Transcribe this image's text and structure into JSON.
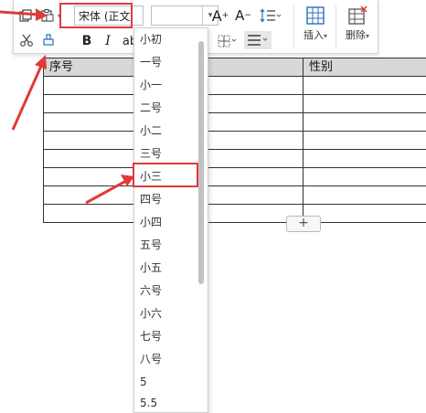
{
  "table": {
    "col1_header": "序号",
    "col3_header": "性别",
    "add_row_label": "+"
  },
  "toolbar": {
    "font_name": "宋体 (正文",
    "size_caret": "▾",
    "bold": "B",
    "italic": "I",
    "strikethrough": "ab",
    "grow_font": "A",
    "shrink_font": "A",
    "insert_label": "插入",
    "delete_label": "删除",
    "dropdown_caret": "▾"
  },
  "size_dropdown": {
    "items": [
      "小初",
      "一号",
      "小一",
      "二号",
      "小二",
      "三号",
      "小三",
      "四号",
      "小四",
      "五号",
      "小五",
      "六号",
      "小六",
      "七号",
      "八号",
      "5",
      "5.5"
    ],
    "highlighted": "小三"
  },
  "colors": {
    "highlight": "#e03a3a",
    "header_fill": "#d8d8d8",
    "table_border": "#333333"
  }
}
